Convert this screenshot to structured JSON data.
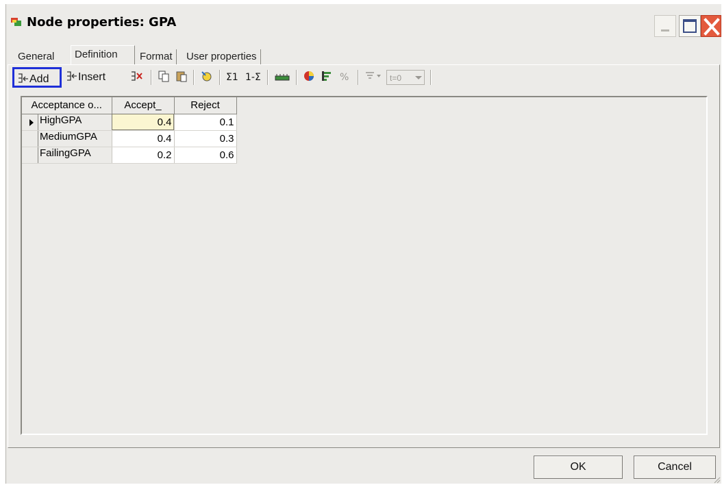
{
  "window": {
    "title": "Node properties: GPA",
    "colors": {
      "background": "#ecebe8",
      "close": "#e35a3d",
      "highlight": "#1e2fd8",
      "selected_cell": "#fbf6d1"
    }
  },
  "tabs": [
    {
      "label": "General",
      "active": false
    },
    {
      "label": "Definition",
      "active": true
    },
    {
      "label": "Format",
      "active": false
    },
    {
      "label": "User properties",
      "active": false
    }
  ],
  "toolbar": {
    "add_label": "Add",
    "insert_label": "Insert",
    "percent_label": "%",
    "time_label": "t=0",
    "icons": [
      "add-column-icon",
      "insert-column-icon",
      "delete-column-icon",
      "copy-icon",
      "paste-icon",
      "randomize-icon",
      "normalize-icon",
      "complement-icon",
      "scale-icon",
      "pie-chart-icon",
      "bar-chart-icon",
      "percent-icon",
      "filter-icon",
      "time-select-icon"
    ]
  },
  "grid": {
    "headers": [
      "Acceptance o...",
      "Accept_",
      "Reject"
    ],
    "rows": [
      {
        "label": "HighGPA",
        "values": [
          "0.4",
          "0.1"
        ],
        "current": true
      },
      {
        "label": "MediumGPA",
        "values": [
          "0.4",
          "0.3"
        ],
        "current": false
      },
      {
        "label": "FailingGPA",
        "values": [
          "0.2",
          "0.6"
        ],
        "current": false
      }
    ]
  },
  "buttons": {
    "ok": "OK",
    "cancel": "Cancel"
  }
}
